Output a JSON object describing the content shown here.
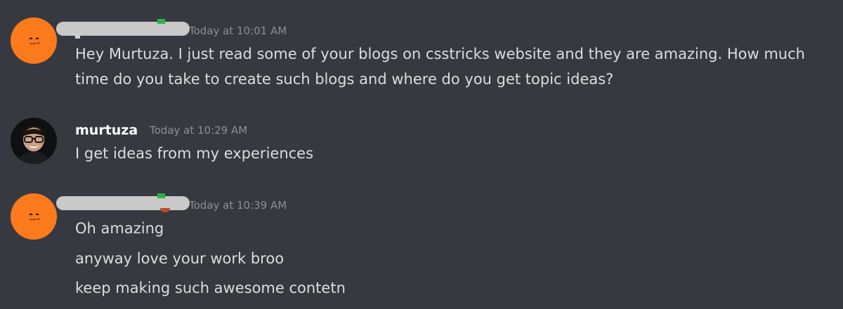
{
  "messages": [
    {
      "username": "",
      "timestamp": "Today at 10:01 AM",
      "lines": [
        "Hey Murtuza. I just read some of your blogs on csstricks website and they are amazing. How much time do you take to create such blogs and where do you get topic ideas?"
      ]
    },
    {
      "username": "murtuza",
      "timestamp": "Today at 10:29 AM",
      "lines": [
        "I get ideas from my experiences"
      ]
    },
    {
      "username": "",
      "timestamp": "Today at 10:39 AM",
      "lines": [
        "Oh amazing",
        "anyway love your work broo",
        "keep making such awesome contetn"
      ]
    }
  ],
  "colors": {
    "background": "#36393f",
    "text": "#dcddde",
    "timestamp": "#8c8f95",
    "avatar_orange": "#fb7a1c",
    "username": "#ffffff"
  },
  "icons": {
    "pumpkin_avatar": "pumpkin-face-icon",
    "photo_avatar": "user-photo-icon"
  }
}
